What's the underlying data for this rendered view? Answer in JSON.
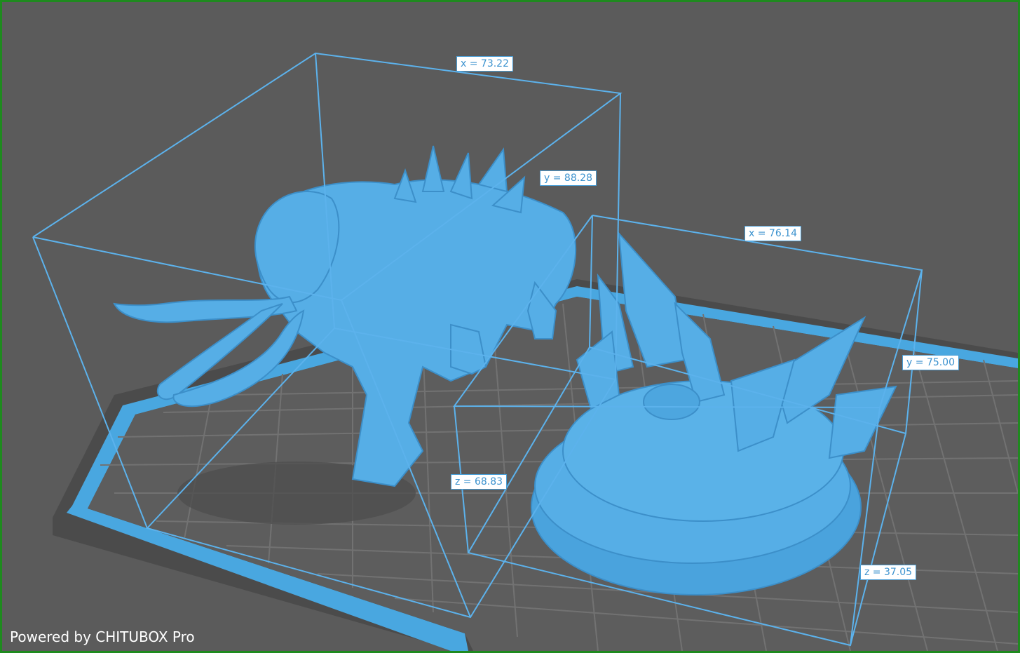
{
  "viewport": {
    "background_color": "#5b5b5b",
    "frame_color": "#1f8a1f",
    "plate_grid_color": "#6a6a6a",
    "plate_rim_color": "#49a7e0",
    "model_color": "#56aee6",
    "bounding_box_color": "#5cb2ec"
  },
  "models": [
    {
      "name": "mammoth",
      "dimensions": {
        "x": "x = 73.22",
        "y": "y = 88.28",
        "z": "z = 68.83"
      }
    },
    {
      "name": "crystal-base",
      "dimensions": {
        "x": "x = 76.14",
        "y": "y = 75.00",
        "z": "z = 37.05"
      }
    }
  ],
  "watermark": "Powered by CHITUBOX Pro"
}
